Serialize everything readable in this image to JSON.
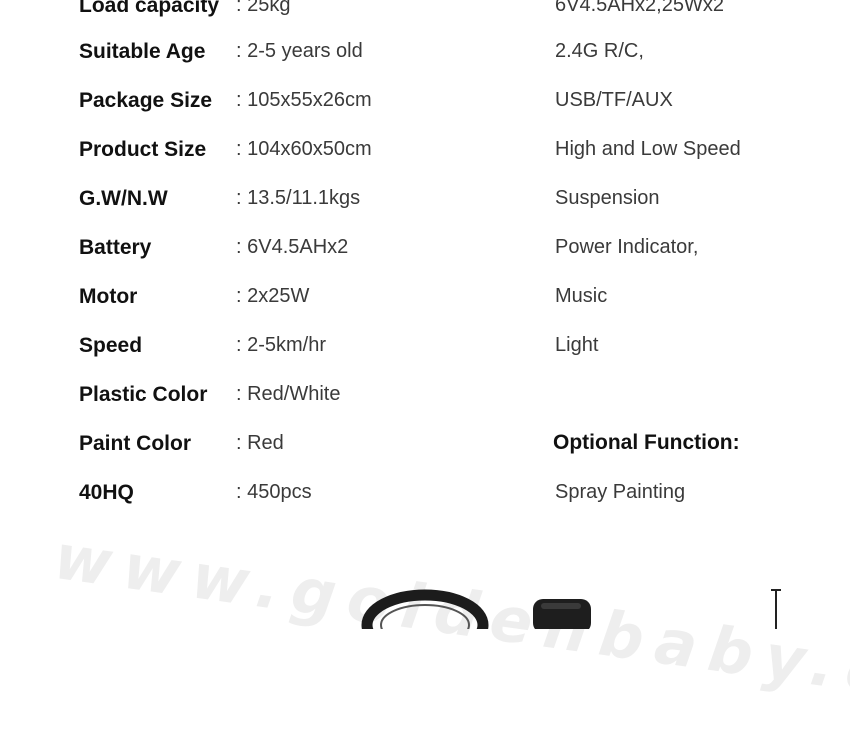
{
  "specs": [
    {
      "label": "Load capacity",
      "value": ": 25kg"
    },
    {
      "label": "Suitable Age",
      "value": ": 2-5 years old"
    },
    {
      "label": "Package Size",
      "value": ": 105x55x26cm"
    },
    {
      "label": "Product Size",
      "value": ": 104x60x50cm"
    },
    {
      "label": "G.W/N.W",
      "value": ": 13.5/11.1kgs"
    },
    {
      "label": "Battery",
      "value": ": 6V4.5AHx2"
    },
    {
      "label": "Motor",
      "value": ": 2x25W"
    },
    {
      "label": "Speed",
      "value": ": 2-5km/hr"
    },
    {
      "label": "Plastic Color",
      "value": ": Red/White"
    },
    {
      "label": "Paint Color",
      "value": ": Red"
    },
    {
      "label": "40HQ",
      "value": ": 450pcs"
    }
  ],
  "features": [
    "6V4.5AHx2,25Wx2",
    "2.4G R/C,",
    "USB/TF/AUX",
    "High and Low Speed",
    "Suspension",
    "Power Indicator,",
    "Music",
    "Light"
  ],
  "optional": {
    "heading": "Optional Function:",
    "items": [
      "Spray Painting"
    ]
  },
  "watermark": "www.goldenbaby.com.cn"
}
